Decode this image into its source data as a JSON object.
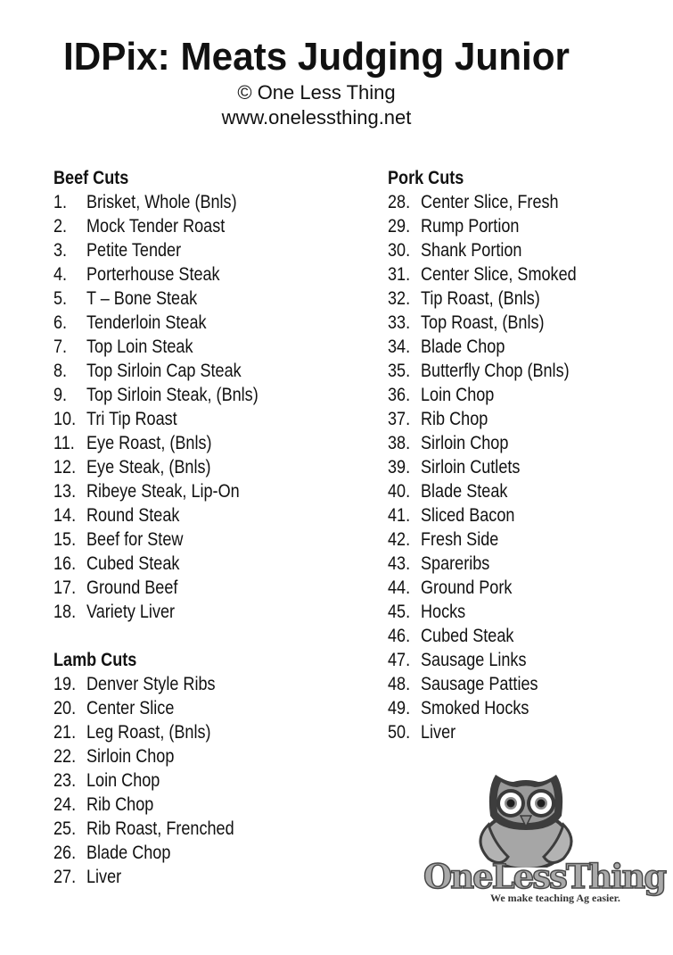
{
  "header": {
    "title": "IDPix: Meats Judging Junior",
    "copyright": "© One Less Thing",
    "website": "www.onelessthing.net"
  },
  "sections": {
    "beef": {
      "title": "Beef Cuts",
      "items": [
        {
          "num": "1.",
          "name": "Brisket, Whole (Bnls)"
        },
        {
          "num": "2.",
          "name": "Mock Tender Roast"
        },
        {
          "num": "3.",
          "name": "Petite Tender"
        },
        {
          "num": "4.",
          "name": "Porterhouse Steak"
        },
        {
          "num": "5.",
          "name": "T – Bone Steak"
        },
        {
          "num": "6.",
          "name": "Tenderloin Steak"
        },
        {
          "num": "7.",
          "name": "Top Loin Steak"
        },
        {
          "num": "8.",
          "name": "Top Sirloin Cap Steak"
        },
        {
          "num": "9.",
          "name": "Top Sirloin Steak, (Bnls)"
        },
        {
          "num": "10.",
          "name": "Tri Tip Roast"
        },
        {
          "num": "11.",
          "name": "Eye Roast, (Bnls)"
        },
        {
          "num": "12.",
          "name": "Eye Steak, (Bnls)"
        },
        {
          "num": "13.",
          "name": "Ribeye Steak, Lip-On"
        },
        {
          "num": "14.",
          "name": "Round Steak"
        },
        {
          "num": "15.",
          "name": "Beef for Stew"
        },
        {
          "num": "16.",
          "name": "Cubed Steak"
        },
        {
          "num": "17.",
          "name": "Ground Beef"
        },
        {
          "num": "18.",
          "name": "Variety Liver"
        }
      ]
    },
    "lamb": {
      "title": "Lamb Cuts",
      "items": [
        {
          "num": "19.",
          "name": "Denver Style Ribs"
        },
        {
          "num": "20.",
          "name": "Center Slice"
        },
        {
          "num": "21.",
          "name": "Leg Roast, (Bnls)"
        },
        {
          "num": "22.",
          "name": "Sirloin Chop"
        },
        {
          "num": "23.",
          "name": "Loin Chop"
        },
        {
          "num": "24.",
          "name": "Rib Chop"
        },
        {
          "num": "25.",
          "name": "Rib Roast, Frenched"
        },
        {
          "num": "26.",
          "name": "Blade Chop"
        },
        {
          "num": "27.",
          "name": "Liver"
        }
      ]
    },
    "pork": {
      "title": "Pork Cuts",
      "items": [
        {
          "num": "28.",
          "name": "Center Slice, Fresh"
        },
        {
          "num": "29.",
          "name": "Rump Portion"
        },
        {
          "num": "30.",
          "name": "Shank Portion"
        },
        {
          "num": "31.",
          "name": "Center Slice, Smoked"
        },
        {
          "num": "32.",
          "name": "Tip Roast, (Bnls)"
        },
        {
          "num": "33.",
          "name": "Top Roast, (Bnls)"
        },
        {
          "num": "34.",
          "name": "Blade Chop"
        },
        {
          "num": "35.",
          "name": "Butterfly Chop (Bnls)"
        },
        {
          "num": "36.",
          "name": "Loin Chop"
        },
        {
          "num": "37.",
          "name": "Rib Chop"
        },
        {
          "num": "38.",
          "name": "Sirloin Chop"
        },
        {
          "num": "39.",
          "name": "Sirloin Cutlets"
        },
        {
          "num": "40.",
          "name": "Blade Steak"
        },
        {
          "num": "41.",
          "name": "Sliced Bacon"
        },
        {
          "num": "42.",
          "name": "Fresh Side"
        },
        {
          "num": "43.",
          "name": "Spareribs"
        },
        {
          "num": "44.",
          "name": "Ground Pork"
        },
        {
          "num": "45.",
          "name": "Hocks"
        },
        {
          "num": "46.",
          "name": "Cubed Steak"
        },
        {
          "num": "47.",
          "name": "Sausage Links"
        },
        {
          "num": "48.",
          "name": "Sausage Patties"
        },
        {
          "num": "49.",
          "name": "Smoked Hocks"
        },
        {
          "num": "50.",
          "name": "Liver"
        }
      ]
    }
  },
  "logo": {
    "icon": "owl-icon",
    "name": "OneLessThing",
    "tagline": "We make teaching Ag easier."
  }
}
